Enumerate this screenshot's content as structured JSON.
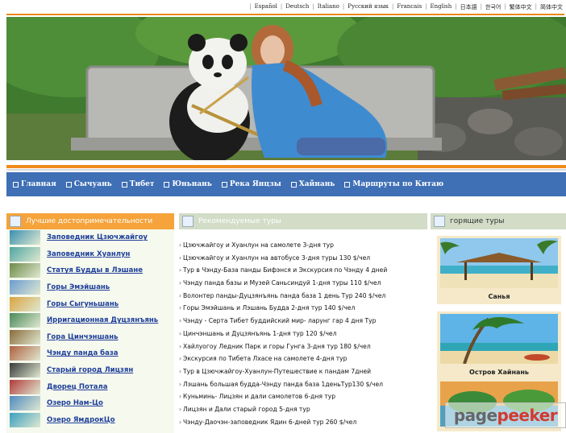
{
  "languages": [
    "Español",
    "Deutsch",
    "Italiano",
    "Русский язык",
    "Francais",
    "English",
    "日本語",
    "한국어",
    "繁体中文",
    "简体中文"
  ],
  "nav": [
    "Главная",
    "Сычуань",
    "Тибет",
    "Юньнань",
    "Река Янцзы",
    "Хайнань",
    "Маршруты по Китаю"
  ],
  "left": {
    "title": "Лучшие достопримечательности",
    "items": [
      {
        "label": "Заповедник Цзючжайгоу",
        "color": "#3a8fb0"
      },
      {
        "label": "Заповедник Хуанлун",
        "color": "#4fa6a0"
      },
      {
        "label": "Статуя Будды в Лэшане",
        "color": "#6d8a4a"
      },
      {
        "label": "Горы Эмэйшань",
        "color": "#6a9bd0"
      },
      {
        "label": "Горы Сыгуньшань",
        "color": "#d9a441"
      },
      {
        "label": "Ирригационная Дуцзянъянь",
        "color": "#4a8a5a"
      },
      {
        "label": "Гора Цинчэншань",
        "color": "#8a6a3a"
      },
      {
        "label": "Чэнду панда база",
        "color": "#b06040"
      },
      {
        "label": "Старый город Лицзян",
        "color": "#3a3a3a"
      },
      {
        "label": "Дворец Потала",
        "color": "#b03a3a"
      },
      {
        "label": "Озеро Нам-Цо",
        "color": "#4f8ac0"
      },
      {
        "label": "Озеро ЯмдрокЦо",
        "color": "#3aa0c0"
      }
    ]
  },
  "mid": {
    "title": "Рекомендуемые туры",
    "tours": [
      "Цзючжайгоу и Хуанлун на самолете 3-дня тур",
      "Цзючжайгоу и Хуанлун на автобусе 3-дня туры 130 $/чел",
      "Тур в Чэнду-База панды Бифэнся и Экскурсия по Чэнду 4 дней",
      "Чэнду панда базы и Музей Саньсиндуй 1-дня туры 110 $/чел",
      "Волонтер панды-Дуцзянъянь панда база 1 день Тур 240 $/чел",
      "Горы Эмэйшань и Лэшань Будда 2-дня тур 140 $/чел",
      "Чэнду - Серта Тибет буддийский мир- ларунг гар 4 дня Тур",
      "Цинчэншань и Дуцзянъянь 1-дня тур 120 $/чел",
      "Хайлуогоу Ледник Парк и горы Гунга 3-дня тур 180 $/чел",
      "Экскурсия по Тибета Лхасе на самолете 4-дня тур",
      "Тур в Цзючжайгоу-Хуанлун-Путешествие к пандам 7дней",
      "Лэшань большая будда-Чэнду панда база 1деньТур130 $/чел",
      "Куньминь- Лицзян и дали самолетов 6-дня тур",
      "Лицзян и Дали старый город 5-дня тур",
      "Чэнду-Даочэн-заповедник Ядин 6-дней тур 260 $/чел"
    ]
  },
  "right": {
    "title": "горящие туры",
    "items": [
      "Санья",
      "Остров Хайнань"
    ]
  },
  "watermark": {
    "a": "page",
    "b": "peeker"
  }
}
